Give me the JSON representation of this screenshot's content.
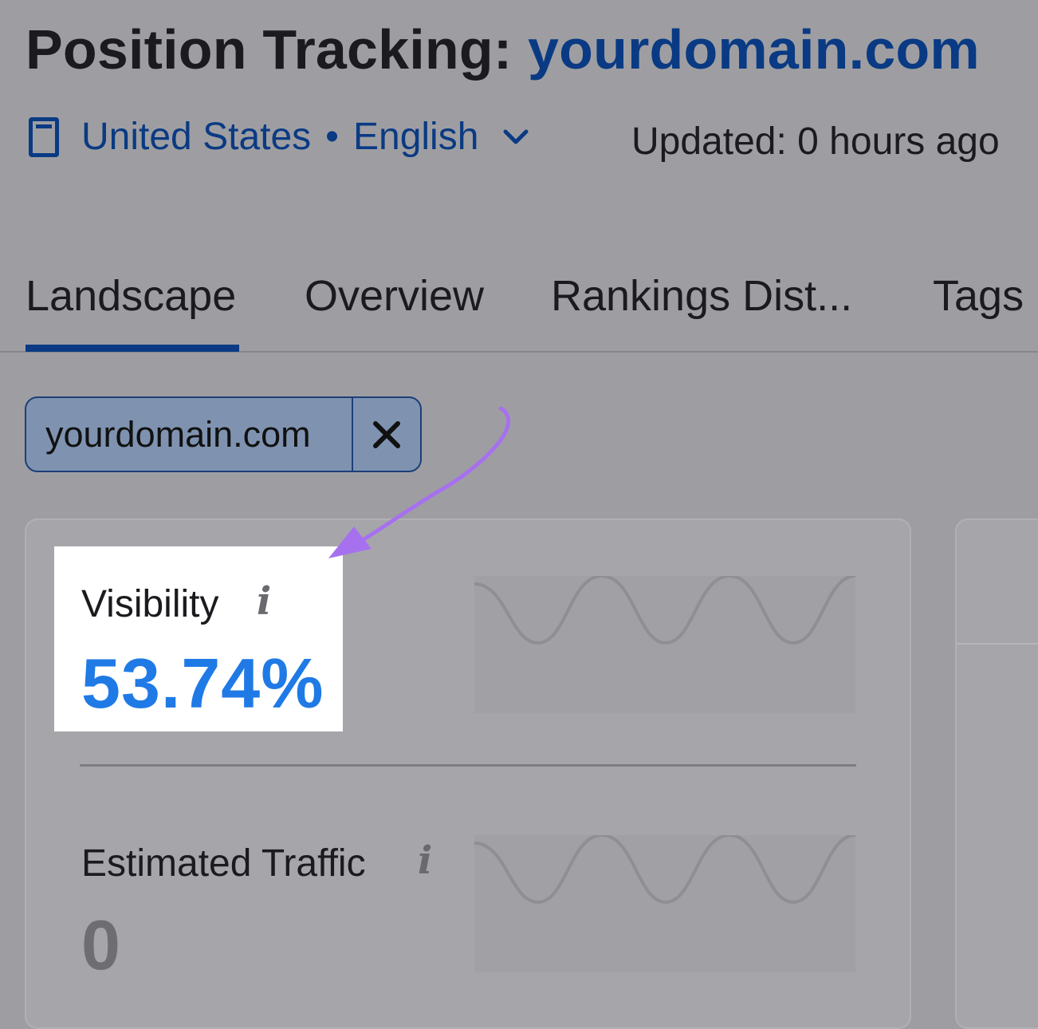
{
  "header": {
    "title_prefix": "Position Tracking:",
    "title_domain": "yourdomain.com",
    "locale": {
      "country": "United States",
      "separator": "•",
      "language": "English",
      "device_icon": "tablet-icon",
      "dropdown_icon": "chevron-down-icon"
    },
    "updated": "Updated: 0 hours ago"
  },
  "tabs": [
    {
      "label": "Landscape",
      "active": true
    },
    {
      "label": "Overview",
      "active": false
    },
    {
      "label": "Rankings Dist...",
      "active": false
    },
    {
      "label": "Tags",
      "active": false
    }
  ],
  "filter_chip": {
    "label": "yourdomain.com",
    "remove_icon": "close-icon"
  },
  "metrics": {
    "visibility": {
      "label": "Visibility",
      "value": "53.74%",
      "info_icon": "info-icon"
    },
    "traffic": {
      "label": "Estimated Traffic",
      "value": "0",
      "info_icon": "info-icon"
    }
  },
  "colors": {
    "brand": "#0a3a83",
    "value_blue": "#1f7ae6",
    "arrow": "#a770ef",
    "overlay": "#9e9ea2"
  }
}
